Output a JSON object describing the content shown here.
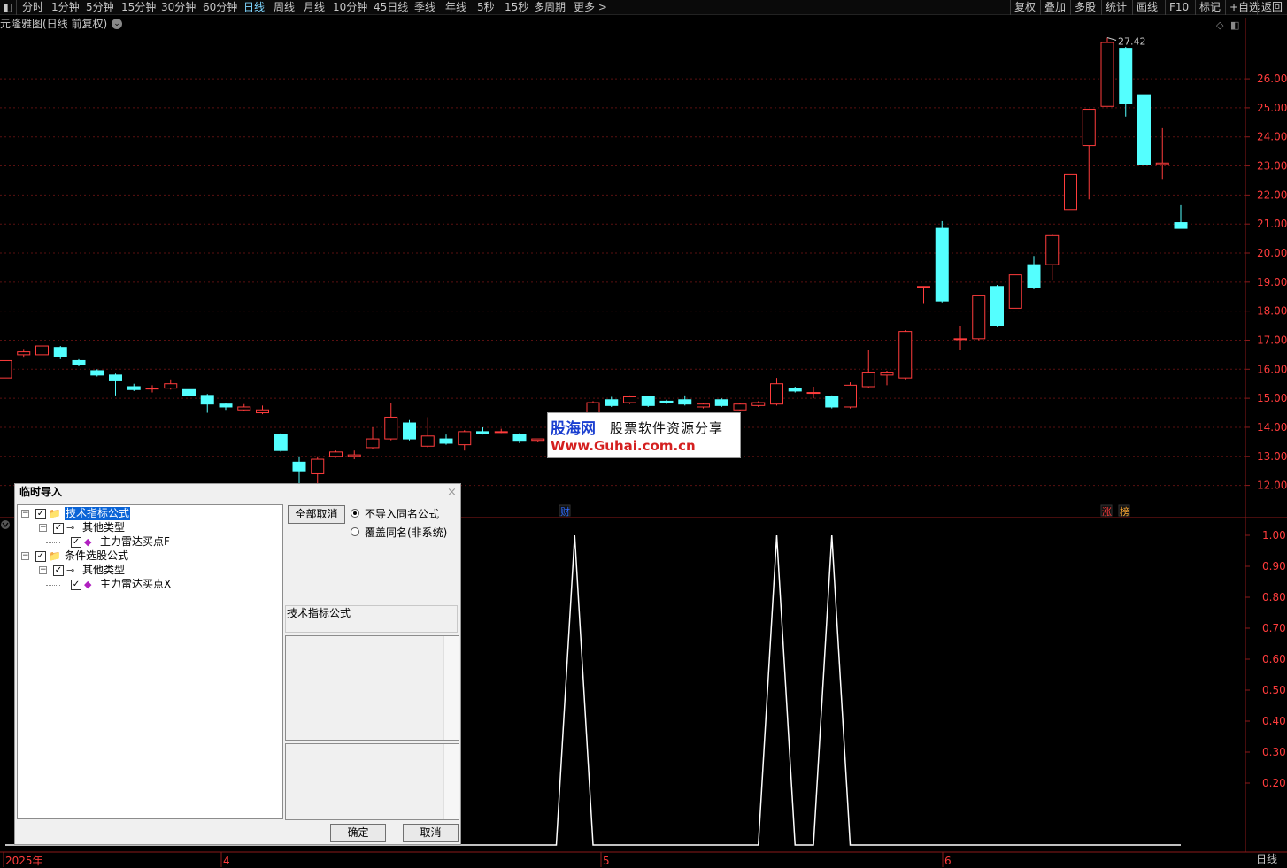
{
  "toolbar": {
    "periods": [
      "分时",
      "1分钟",
      "5分钟",
      "15分钟",
      "30分钟",
      "60分钟",
      "日线",
      "周线",
      "月线",
      "10分钟",
      "45日线",
      "季线",
      "年线",
      "5秒",
      "15秒",
      "多周期",
      "更多 >"
    ],
    "active_period": "日线",
    "right_buttons": [
      "复权",
      "叠加",
      "多股",
      "统计",
      "画线",
      "F10",
      "标记",
      "+自选",
      "返回"
    ]
  },
  "chart": {
    "title": "元隆雅图(日线 前复权)",
    "high_label": "27.42",
    "price_ticks": [
      "26.00",
      "25.00",
      "24.00",
      "23.00",
      "22.00",
      "21.00",
      "20.00",
      "19.00",
      "18.00",
      "17.00",
      "16.00",
      "15.00",
      "14.00",
      "13.00",
      "12.00"
    ],
    "indicator_ticks": [
      "1.00",
      "0.90",
      "0.80",
      "0.70",
      "0.60",
      "0.50",
      "0.40",
      "0.30",
      "0.20"
    ],
    "date_labels": [
      "2025年",
      "4",
      "5",
      "6"
    ],
    "x_axis_label": "日线",
    "event_markers": [
      "财",
      "涨",
      "榜"
    ],
    "up_color": "#ff3c3c",
    "down_color": "#54ffff"
  },
  "chart_data": {
    "type": "candlestick",
    "ylim": [
      11.5,
      27.8
    ],
    "candles": [
      {
        "o": 15.7,
        "c": 16.3,
        "h": 16.3,
        "l": 15.7
      },
      {
        "o": 16.5,
        "c": 16.6,
        "h": 16.7,
        "l": 16.4
      },
      {
        "o": 16.5,
        "c": 16.8,
        "h": 16.95,
        "l": 16.35
      },
      {
        "o": 16.75,
        "c": 16.45,
        "h": 16.8,
        "l": 16.35
      },
      {
        "o": 16.3,
        "c": 16.15,
        "h": 16.35,
        "l": 16.1
      },
      {
        "o": 15.95,
        "c": 15.8,
        "h": 16.0,
        "l": 15.75
      },
      {
        "o": 15.8,
        "c": 15.6,
        "h": 15.85,
        "l": 15.1
      },
      {
        "o": 15.4,
        "c": 15.3,
        "h": 15.5,
        "l": 15.25
      },
      {
        "o": 15.35,
        "c": 15.35,
        "h": 15.45,
        "l": 15.2
      },
      {
        "o": 15.35,
        "c": 15.5,
        "h": 15.65,
        "l": 15.3
      },
      {
        "o": 15.3,
        "c": 15.1,
        "h": 15.35,
        "l": 15.05
      },
      {
        "o": 15.1,
        "c": 14.8,
        "h": 15.15,
        "l": 14.5
      },
      {
        "o": 14.8,
        "c": 14.7,
        "h": 14.85,
        "l": 14.6
      },
      {
        "o": 14.6,
        "c": 14.7,
        "h": 14.8,
        "l": 14.55
      },
      {
        "o": 14.5,
        "c": 14.6,
        "h": 14.75,
        "l": 14.45
      },
      {
        "o": 13.75,
        "c": 13.2,
        "h": 13.8,
        "l": 13.15
      },
      {
        "o": 12.8,
        "c": 12.5,
        "h": 13.0,
        "l": 11.9
      },
      {
        "o": 12.4,
        "c": 12.9,
        "h": 13.0,
        "l": 11.6
      },
      {
        "o": 13.0,
        "c": 13.15,
        "h": 13.2,
        "l": 12.95
      },
      {
        "o": 13.0,
        "c": 13.05,
        "h": 13.2,
        "l": 12.9
      },
      {
        "o": 13.3,
        "c": 13.6,
        "h": 14.0,
        "l": 13.25
      },
      {
        "o": 13.6,
        "c": 14.35,
        "h": 14.85,
        "l": 13.55
      },
      {
        "o": 14.15,
        "c": 13.6,
        "h": 14.25,
        "l": 13.55
      },
      {
        "o": 13.35,
        "c": 13.7,
        "h": 14.35,
        "l": 13.3
      },
      {
        "o": 13.6,
        "c": 13.45,
        "h": 13.75,
        "l": 13.4
      },
      {
        "o": 13.4,
        "c": 13.85,
        "h": 13.9,
        "l": 13.2
      },
      {
        "o": 13.85,
        "c": 13.8,
        "h": 14.0,
        "l": 13.75
      },
      {
        "o": 13.85,
        "c": 13.85,
        "h": 13.95,
        "l": 13.8
      },
      {
        "o": 13.75,
        "c": 13.55,
        "h": 13.8,
        "l": 13.45
      },
      {
        "o": 13.55,
        "c": 13.6,
        "h": 13.6,
        "l": 13.5
      },
      {
        "o": 13.6,
        "c": 13.6,
        "h": 13.65,
        "l": 13.55
      },
      {
        "o": 14.0,
        "c": 14.3,
        "h": 14.5,
        "l": 13.95
      },
      {
        "o": 14.5,
        "c": 14.85,
        "h": 14.9,
        "l": 14.45
      },
      {
        "o": 14.95,
        "c": 14.75,
        "h": 15.05,
        "l": 14.7
      },
      {
        "o": 14.85,
        "c": 15.05,
        "h": 15.1,
        "l": 14.8
      },
      {
        "o": 15.05,
        "c": 14.75,
        "h": 15.05,
        "l": 14.7
      },
      {
        "o": 14.9,
        "c": 14.85,
        "h": 14.95,
        "l": 14.8
      },
      {
        "o": 14.95,
        "c": 14.8,
        "h": 15.1,
        "l": 14.75
      },
      {
        "o": 14.7,
        "c": 14.8,
        "h": 14.85,
        "l": 14.65
      },
      {
        "o": 14.95,
        "c": 14.75,
        "h": 15.0,
        "l": 14.7
      },
      {
        "o": 14.6,
        "c": 14.8,
        "h": 14.85,
        "l": 14.55
      },
      {
        "o": 14.75,
        "c": 14.85,
        "h": 14.9,
        "l": 14.7
      },
      {
        "o": 14.8,
        "c": 15.5,
        "h": 15.7,
        "l": 14.75
      },
      {
        "o": 15.35,
        "c": 15.25,
        "h": 15.4,
        "l": 15.2
      },
      {
        "o": 15.2,
        "c": 15.2,
        "h": 15.4,
        "l": 15.0
      },
      {
        "o": 15.05,
        "c": 14.7,
        "h": 15.1,
        "l": 14.65
      },
      {
        "o": 14.7,
        "c": 15.45,
        "h": 15.55,
        "l": 14.65
      },
      {
        "o": 15.4,
        "c": 15.9,
        "h": 16.65,
        "l": 15.35
      },
      {
        "o": 15.8,
        "c": 15.9,
        "h": 15.95,
        "l": 15.45
      },
      {
        "o": 15.7,
        "c": 17.3,
        "h": 17.35,
        "l": 15.65
      },
      {
        "o": 18.85,
        "c": 18.85,
        "h": 18.85,
        "l": 18.25
      },
      {
        "o": 20.85,
        "c": 18.35,
        "h": 21.1,
        "l": 18.3
      },
      {
        "o": 17.05,
        "c": 17.05,
        "h": 17.5,
        "l": 16.65
      },
      {
        "o": 17.05,
        "c": 18.55,
        "h": 18.55,
        "l": 17.0
      },
      {
        "o": 18.85,
        "c": 17.5,
        "h": 18.9,
        "l": 17.45
      },
      {
        "o": 18.1,
        "c": 19.25,
        "h": 19.25,
        "l": 18.1
      },
      {
        "o": 19.6,
        "c": 18.8,
        "h": 19.9,
        "l": 18.75
      },
      {
        "o": 19.6,
        "c": 20.6,
        "h": 20.65,
        "l": 19.05
      },
      {
        "o": 21.5,
        "c": 22.7,
        "h": 22.7,
        "l": 21.5
      },
      {
        "o": 23.7,
        "c": 24.95,
        "h": 24.95,
        "l": 21.85
      },
      {
        "o": 25.05,
        "c": 27.25,
        "h": 27.42,
        "l": 25.05
      },
      {
        "o": 27.05,
        "c": 25.15,
        "h": 27.1,
        "l": 24.7
      },
      {
        "o": 25.45,
        "c": 23.05,
        "h": 25.5,
        "l": 22.85
      },
      {
        "o": 23.05,
        "c": 23.1,
        "h": 24.3,
        "l": 22.55
      },
      {
        "o": 21.05,
        "c": 20.85,
        "h": 21.65,
        "l": 20.85
      }
    ],
    "indicator_series": [
      {
        "name": "主力雷达买点",
        "values": [
          0,
          0,
          0,
          0,
          0,
          0,
          0,
          0,
          0,
          0,
          0,
          0,
          0,
          0,
          0,
          0,
          0,
          0,
          0,
          0,
          0,
          0,
          0,
          0,
          0,
          0,
          0,
          0,
          0,
          0,
          0,
          1,
          0,
          0,
          0,
          0,
          0,
          0,
          0,
          0,
          0,
          0,
          1,
          0,
          0,
          1,
          0,
          0,
          0,
          0,
          0,
          0,
          0,
          0,
          0,
          0,
          0,
          0,
          0,
          0,
          0,
          0,
          0,
          0,
          0
        ]
      }
    ],
    "indicator_ylim": [
      0,
      1.0
    ]
  },
  "watermark": {
    "brand": "股海网",
    "tagline": "股票软件资源分享",
    "url": "Www.Guhai.com.cn"
  },
  "dialog": {
    "title": "临时导入",
    "close": "×",
    "tree": [
      {
        "label": "技术指标公式",
        "level": 0,
        "checked": true,
        "icon": "folder",
        "selected": true
      },
      {
        "label": "其他类型",
        "level": 1,
        "checked": true,
        "icon": "key"
      },
      {
        "label": "主力雷达买点F",
        "level": 2,
        "checked": true,
        "icon": "formula"
      },
      {
        "label": "条件选股公式",
        "level": 0,
        "checked": true,
        "icon": "folder",
        "selected": false
      },
      {
        "label": "其他类型",
        "level": 1,
        "checked": true,
        "icon": "key"
      },
      {
        "label": "主力雷达买点X",
        "level": 2,
        "checked": true,
        "icon": "formula"
      }
    ],
    "deselect_all": "全部取消",
    "radio_options": [
      "不导入同名公式",
      "覆盖同名(非系统)"
    ],
    "radio_selected": 0,
    "info_text": "技术指标公式",
    "ok": "确定",
    "cancel": "取消"
  }
}
